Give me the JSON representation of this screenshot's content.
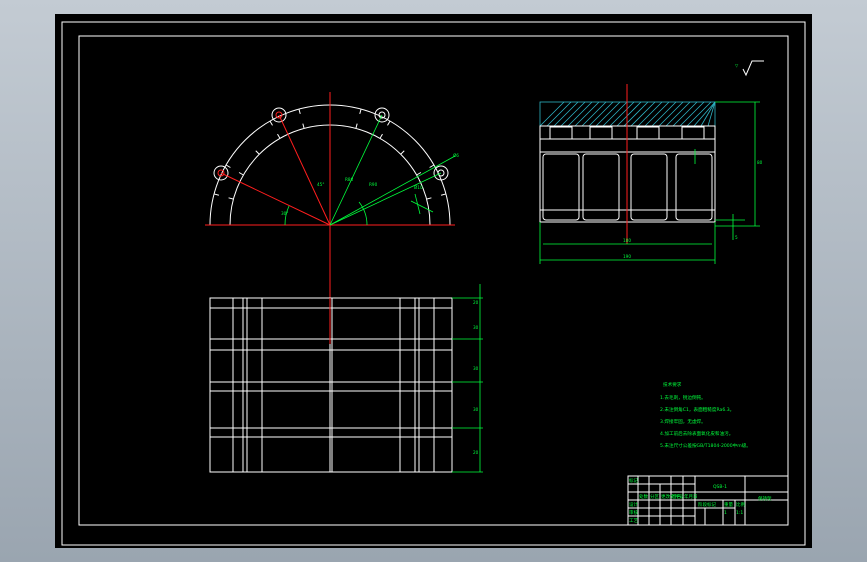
{
  "drawing": {
    "background_color": "#000000",
    "line_color": "#ffffff",
    "centerline_color": "#ff1e1e",
    "dimension_color": "#00ff3c",
    "hatch_color": "#2fb3c4"
  },
  "roughness_label": "▽",
  "dims": {
    "angle_1": "30°",
    "angle_2": "45°",
    "radius_1": "R80",
    "radius_2": "R90",
    "detail_a": "Ø10",
    "detail_b": "Ø6",
    "side_height": "80",
    "side_inner_width": "180",
    "side_total_width": "190",
    "side_small": "5",
    "front_rows": [
      "20",
      "30",
      "30",
      "30",
      "20"
    ]
  },
  "notes": {
    "title": "技术要求",
    "items": [
      "1.去毛刺，锐边倒钝。",
      "2.未注倒角C1，表面粗糙度Ra6.3。",
      "3.焊接牢固，无虚焊。",
      "4.加工前后去除表面氧化皮和油污。",
      "5.未注尺寸公差按GB/T1804-2000中m级。"
    ]
  },
  "title_block": {
    "drawing_code": "QSB-1",
    "part_name": "保持架",
    "scale": "1:1",
    "sheet": "1",
    "labels": [
      "标记",
      "处数",
      "分区",
      "更改文件号",
      "签名",
      "年月日"
    ],
    "row_labels": [
      "设计",
      "审核",
      "工艺",
      "批准"
    ],
    "stage": "阶段标记",
    "weight": "重量",
    "ratio": "比例"
  }
}
